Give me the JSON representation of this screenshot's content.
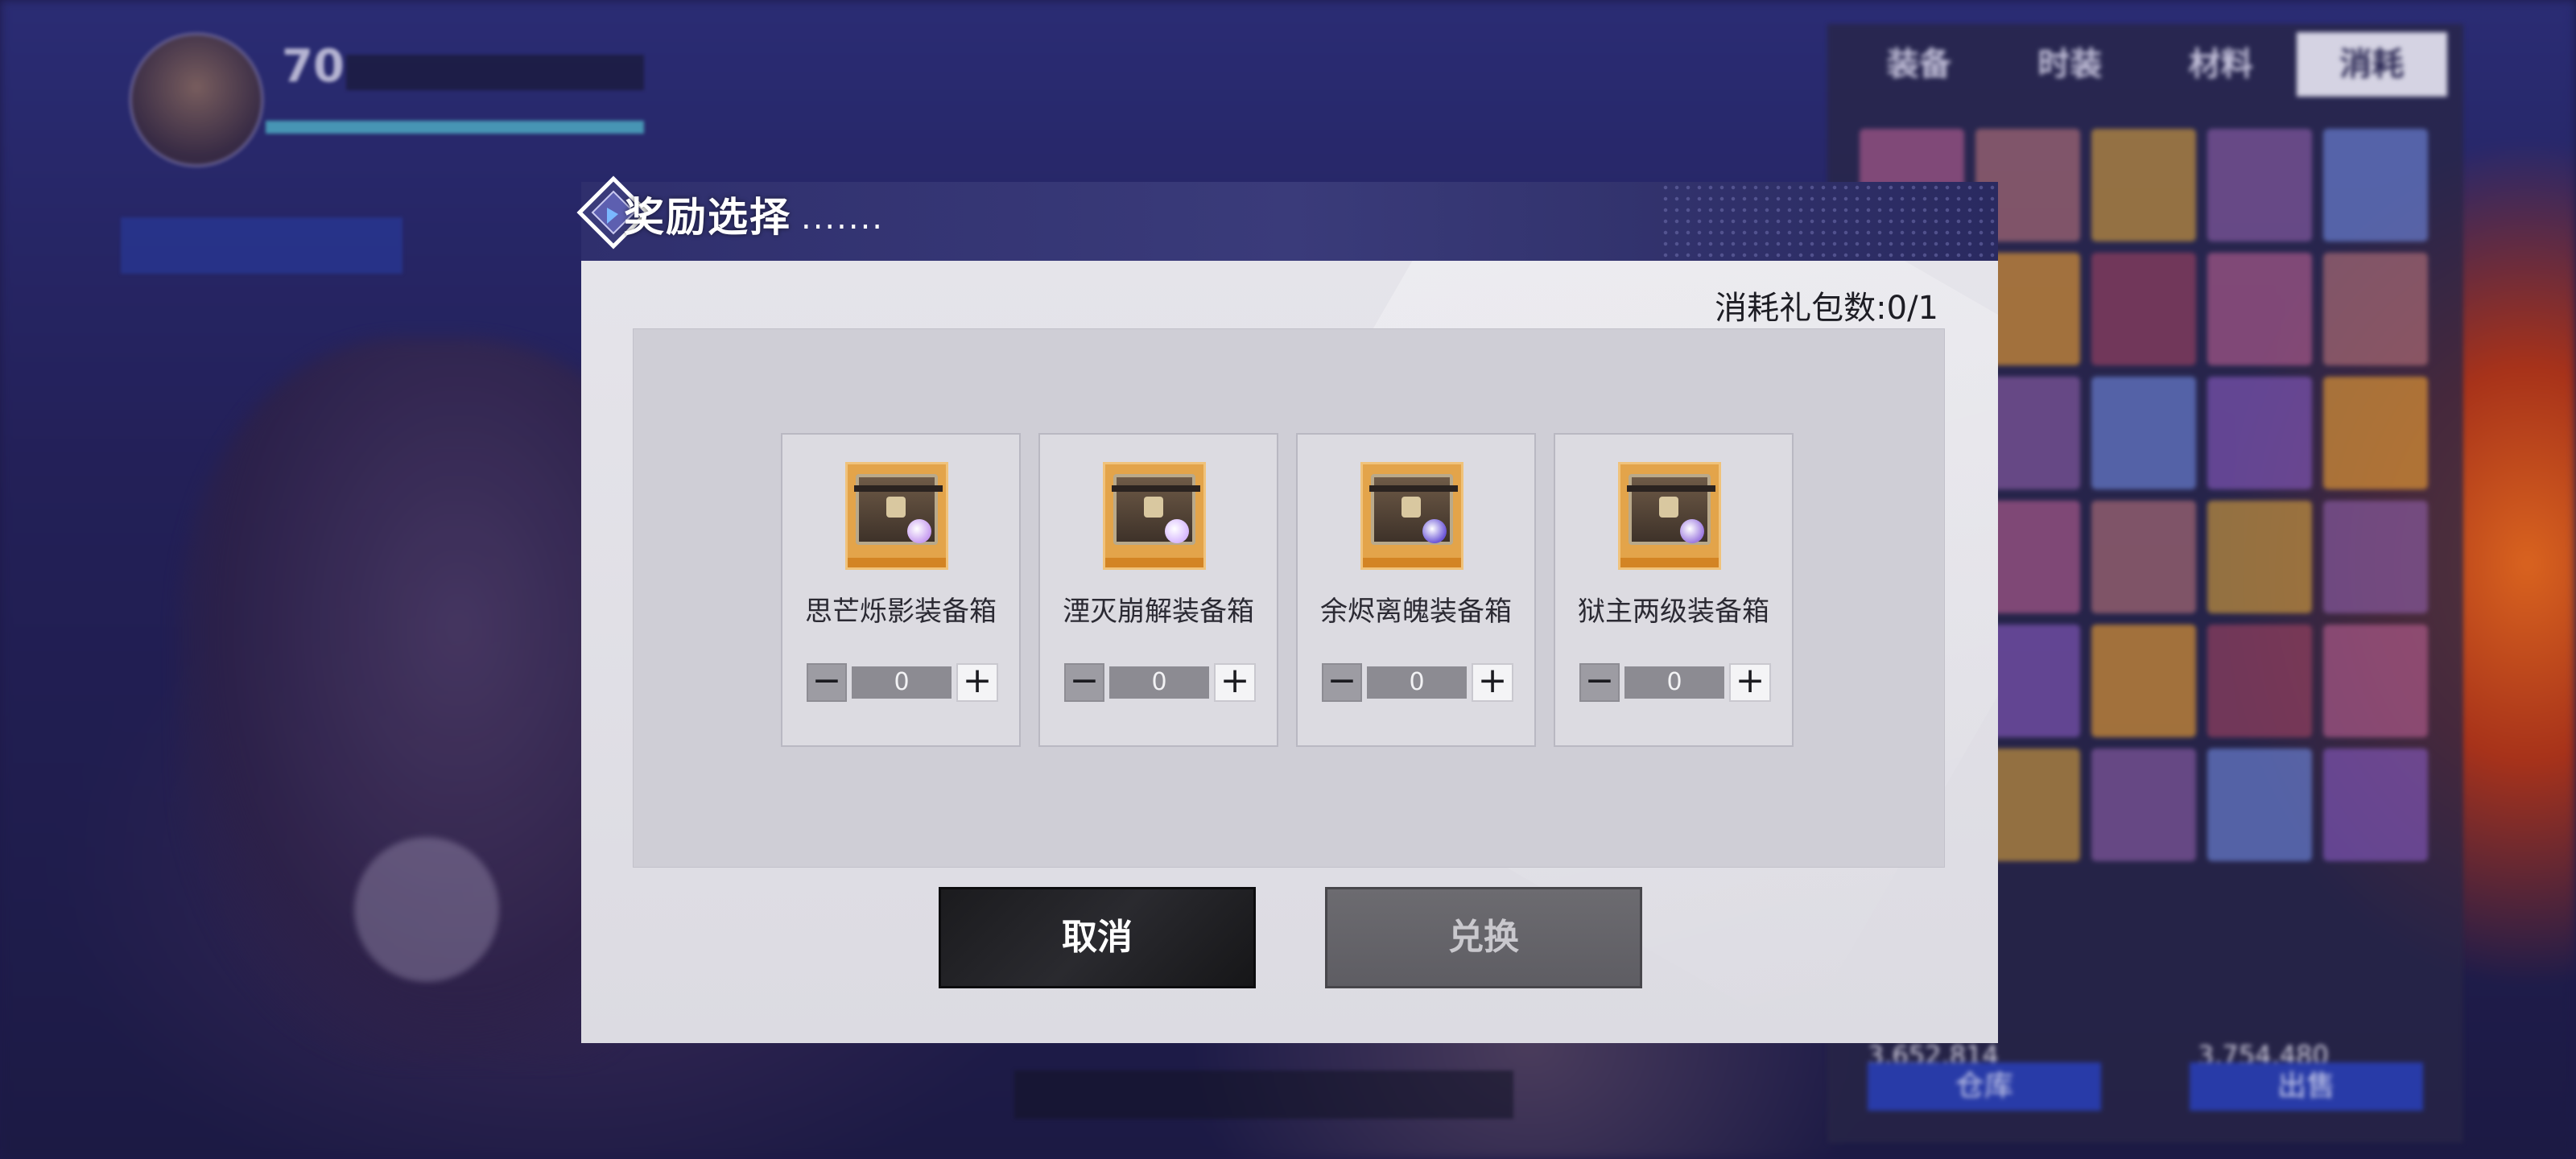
{
  "player": {
    "level": "70"
  },
  "inventory": {
    "tabs": [
      "装备",
      "时装",
      "材料",
      "消耗"
    ],
    "active_tab": "消耗",
    "currency1": "3,652,814",
    "currency2": "3,754,480",
    "button_warehouse": "仓库",
    "button_sell": "出售"
  },
  "dialog": {
    "title": "奖励选择",
    "title_dots": ".......",
    "counter_label": "消耗礼包数:0/1",
    "items": [
      {
        "name": "思芒烁影装备箱",
        "quantity": "0",
        "minus": "−",
        "plus": "+",
        "gem_color": "#c79cf0"
      },
      {
        "name": "湮灭崩解装备箱",
        "quantity": "0",
        "minus": "−",
        "plus": "+",
        "gem_color": "#d7b8ff"
      },
      {
        "name": "余烬离魄装备箱",
        "quantity": "0",
        "minus": "−",
        "plus": "+",
        "gem_color": "#6b55d8"
      },
      {
        "name": "狱主两级装备箱",
        "quantity": "0",
        "minus": "−",
        "plus": "+",
        "gem_color": "#9d7ae0"
      }
    ],
    "cancel_label": "取消",
    "exchange_label": "兑换"
  },
  "colors": {
    "header": "#2f2f6d",
    "panel": "#e5e4ea",
    "item_frame": "#e3a44a",
    "cancel_bg": "#1b1b1e",
    "exchange_bg": "#646368"
  }
}
